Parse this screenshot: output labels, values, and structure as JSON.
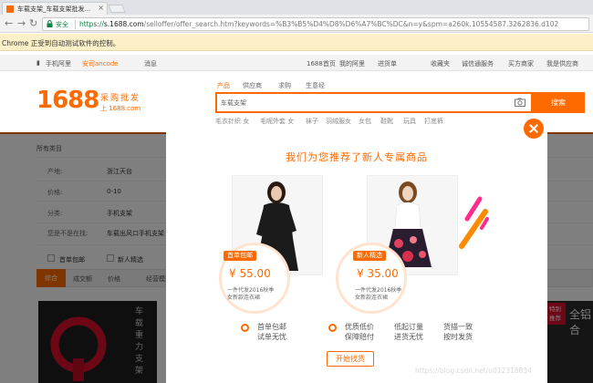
{
  "browser": {
    "tab_title": "车载支架_车载支架批发...",
    "tab_close": "×",
    "secure_label": "安全",
    "url_proto": "https://",
    "url_host": "s.1688.com",
    "url_rest": "/selloffer/offer_search.htm?keywords=%B3%B5%D4%D8%D6%A7%BC%DC&n=y&spm=a260k.10554587.3262836.d102",
    "infobar_text": "Chrome 正受到自动测试软件的控制。"
  },
  "site_nav": {
    "left": [
      "手机阿里",
      "安司ancode",
      "消息"
    ],
    "right": [
      "1688首页",
      "我的阿里",
      "进货单",
      "收藏夹",
      "诚信通服务",
      "买方商家",
      "我是供应商"
    ]
  },
  "header": {
    "logo": "1688",
    "logo_cn": "采购批发",
    "logo_url": "上 1688.com",
    "search_tabs": [
      "产品",
      "供应商",
      "求购",
      "生意经"
    ],
    "search_value": "车载支架",
    "search_button": "搜索",
    "hot_words": [
      "毛衣针织 女",
      "毛呢外套 女",
      "袜子",
      "羽绒服女",
      "女包",
      "鞋靴",
      "玩具",
      "打底裤"
    ]
  },
  "filters": {
    "all_categories": "所有类目",
    "rows": [
      {
        "label": "产地:",
        "value": "浙江天台"
      },
      {
        "label": "价格:",
        "value": "0-10"
      },
      {
        "label": "分类:",
        "value": "手机支架"
      },
      {
        "label": "您是不是在找:",
        "value": "车载出风口手机支架"
      }
    ],
    "checkbox_1": "首单包邮",
    "checkbox_2": "新人精选"
  },
  "sort_bar": {
    "items": [
      "综合",
      "成交额",
      "价格",
      "经营模式"
    ]
  },
  "products": {
    "title_vertical": "车载重力支架",
    "side_tag_1": "特别",
    "side_tag_2": "推荐",
    "side_text": "全铝合"
  },
  "modal": {
    "title": "我们为您推荐了新人专属商品",
    "cards": [
      {
        "tag": "首单包邮",
        "price": "¥ 55.00",
        "desc_line1": "一件代发2016秋季",
        "desc_line2": "女新款连衣裙"
      },
      {
        "tag": "新人精选",
        "price": "¥ 35.00",
        "desc_line1": "一件代发2016秋季",
        "desc_line2": "女新款连衣裙"
      }
    ],
    "features": [
      {
        "line1": "首单包邮",
        "line2": "试单无忧"
      },
      {
        "line1": "优质低价",
        "line2": "保障赔付"
      },
      {
        "line1": "低起订量",
        "line2": "进货无忧"
      },
      {
        "line1": "货描一致",
        "line2": "按时发货"
      }
    ],
    "start_button": "开始找货"
  },
  "watermark": "https://blog.csdn.net/u012318834",
  "colors": {
    "accent": "#ff6a00",
    "infobar": "#fbf0c8",
    "secure": "#0b8043"
  }
}
